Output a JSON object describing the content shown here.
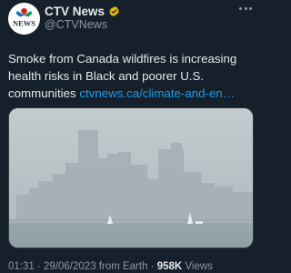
{
  "tweet": {
    "author": {
      "display_name": "CTV News",
      "handle": "@CTVNews",
      "verified_badge_icon": "verified-badge-icon",
      "avatar_logo_text": "NEWS",
      "avatar_icon": "ctv-logo-icon"
    },
    "text": {
      "line1": "Smoke from Canada wildfires is increasing",
      "line2": "health risks in Black and poorer U.S.",
      "line3": "communities",
      "link": "ctvnews.ca/climate-and-en…"
    },
    "media": {
      "icon": "hazy-skyline-photo"
    },
    "meta": {
      "time": "01:31",
      "date": "29/06/2023",
      "source": "from Earth",
      "separator": "·",
      "views_count": "958K",
      "views_label": "Views"
    },
    "more_icon": "more-options-icon"
  }
}
